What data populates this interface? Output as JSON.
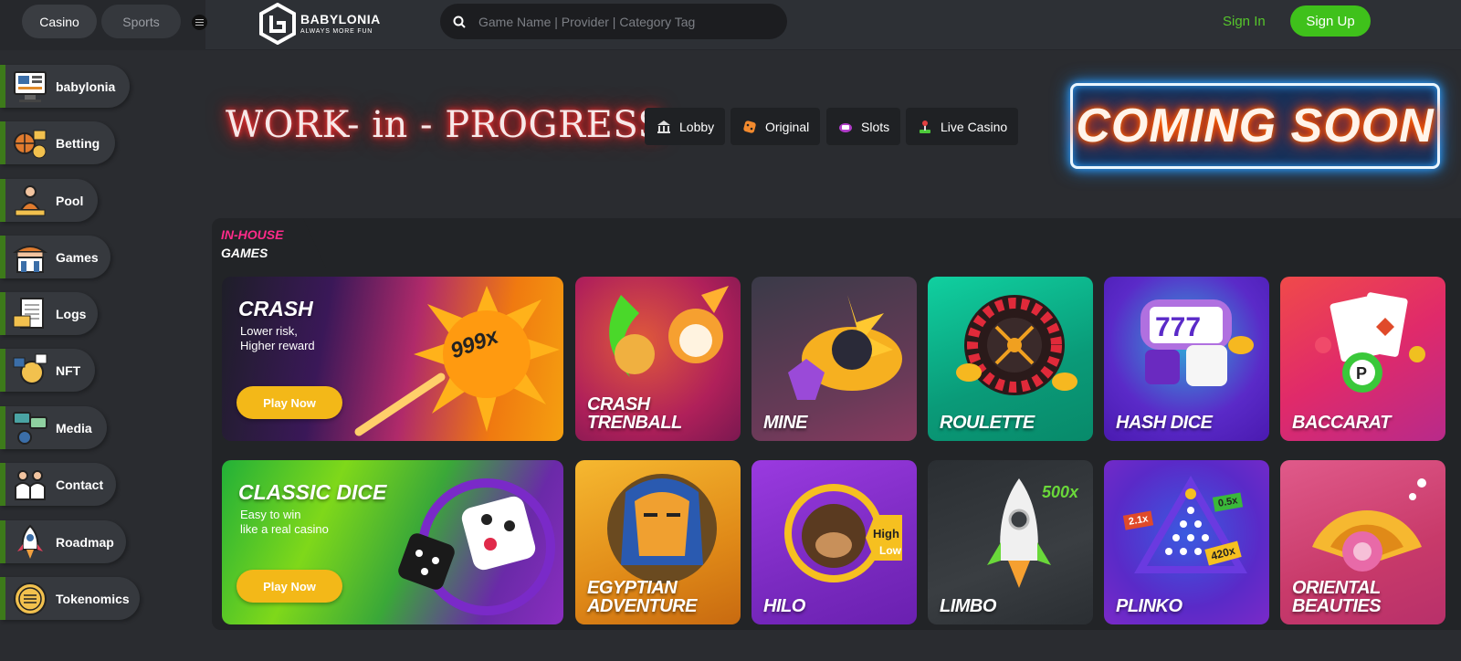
{
  "header": {
    "tabs": [
      "Casino",
      "Sports"
    ],
    "logo_title": "BABYLONIA",
    "logo_tagline": "ALWAYS MORE FUN",
    "search_placeholder": "Game Name | Provider | Category Tag",
    "sign_in": "Sign In",
    "sign_up": "Sign Up"
  },
  "sidebar": {
    "items": [
      {
        "label": "babylonia",
        "icon": "computer-icon"
      },
      {
        "label": "Betting",
        "icon": "basketball-bet-icon"
      },
      {
        "label": "Pool",
        "icon": "people-pool-icon"
      },
      {
        "label": "Games",
        "icon": "casino-building-icon"
      },
      {
        "label": "Logs",
        "icon": "log-document-icon"
      },
      {
        "label": "NFT",
        "icon": "nft-coin-icon"
      },
      {
        "label": "Media",
        "icon": "media-chat-icon"
      },
      {
        "label": "Contact",
        "icon": "contact-people-icon"
      },
      {
        "label": "Roadmap",
        "icon": "rocket-icon"
      },
      {
        "label": "Tokenomics",
        "icon": "token-coin-icon"
      }
    ]
  },
  "banner": {
    "wip": "WORK- in - PROGRESS",
    "coming_soon": "COMING SOON",
    "nav": [
      {
        "label": "Lobby",
        "icon": "bank-icon"
      },
      {
        "label": "Original",
        "icon": "dice-icon"
      },
      {
        "label": "Slots",
        "icon": "slot-machine-icon"
      },
      {
        "label": "Live Casino",
        "icon": "joystick-icon"
      }
    ]
  },
  "games_section": {
    "title_line1": "IN-HOUSE",
    "title_line2": "GAMES"
  },
  "featured": [
    {
      "title": "CRASH",
      "subtitle": "Lower risk,\nHigher reward",
      "button": "Play Now",
      "badge": "999x"
    },
    {
      "title": "CLASSIC DICE",
      "subtitle": "Easy to win\nlike a real casino",
      "button": "Play Now"
    }
  ],
  "games": [
    {
      "name": "CRASH\nTRENBALL"
    },
    {
      "name": "MINE"
    },
    {
      "name": "ROULETTE"
    },
    {
      "name": "HASH DICE"
    },
    {
      "name": "BACCARAT"
    },
    {
      "name": "EGYPTIAN\nADVENTURE"
    },
    {
      "name": "HILO",
      "high": "High",
      "low": "Low"
    },
    {
      "name": "LIMBO",
      "mult": "500x"
    },
    {
      "name": "PLINKO",
      "m1": "2.1x",
      "m2": "0.5x",
      "m3": "420x"
    },
    {
      "name": "ORIENTAL\nBEAUTIES"
    }
  ],
  "colors": {
    "accent_green": "#3fc11b",
    "pink": "#ff2b8a",
    "gold": "#f3b818"
  }
}
